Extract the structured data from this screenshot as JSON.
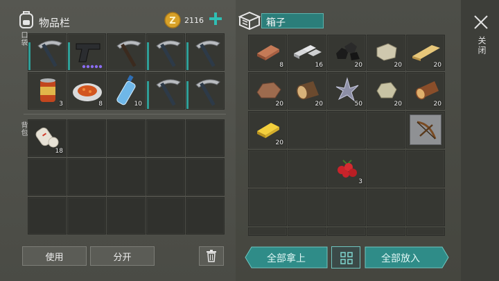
{
  "inventory": {
    "title": "物品栏",
    "coins": "2116",
    "pocket_label": "口袋",
    "backpack_label": "背包",
    "pocket_items": [
      {
        "name": "pickaxe",
        "count": ""
      },
      {
        "name": "pistol",
        "count": ""
      },
      {
        "name": "pickaxe",
        "count": ""
      },
      {
        "name": "pickaxe",
        "count": ""
      },
      {
        "name": "pickaxe",
        "count": ""
      },
      {
        "name": "canned-food",
        "count": "3"
      },
      {
        "name": "plate-of-food",
        "count": "8"
      },
      {
        "name": "water-bottle",
        "count": "10"
      },
      {
        "name": "pickaxe",
        "count": ""
      },
      {
        "name": "pickaxe",
        "count": ""
      }
    ],
    "backpack_items": [
      {
        "name": "bandage",
        "count": "18"
      }
    ]
  },
  "buttons": {
    "use": "使用",
    "split": "分开",
    "take_all": "全部拿上",
    "put_all": "全部放入"
  },
  "box": {
    "title": "箱子",
    "items": [
      {
        "name": "copper-ingot",
        "count": "8"
      },
      {
        "name": "iron-ingot",
        "count": "16"
      },
      {
        "name": "coal",
        "count": "20"
      },
      {
        "name": "stone-block",
        "count": "20"
      },
      {
        "name": "wood-plank",
        "count": "20"
      },
      {
        "name": "copper-ore",
        "count": "20"
      },
      {
        "name": "log",
        "count": "20"
      },
      {
        "name": "crystal",
        "count": "50"
      },
      {
        "name": "stone",
        "count": "20"
      },
      {
        "name": "wood-log",
        "count": "20"
      },
      {
        "name": "gold-ingot",
        "count": "20"
      },
      {
        "name": "berries",
        "count": "3"
      }
    ]
  },
  "close_label": "关闭",
  "colors": {
    "accent": "#2f8c88",
    "box_title_bg": "#2b7e7a"
  }
}
